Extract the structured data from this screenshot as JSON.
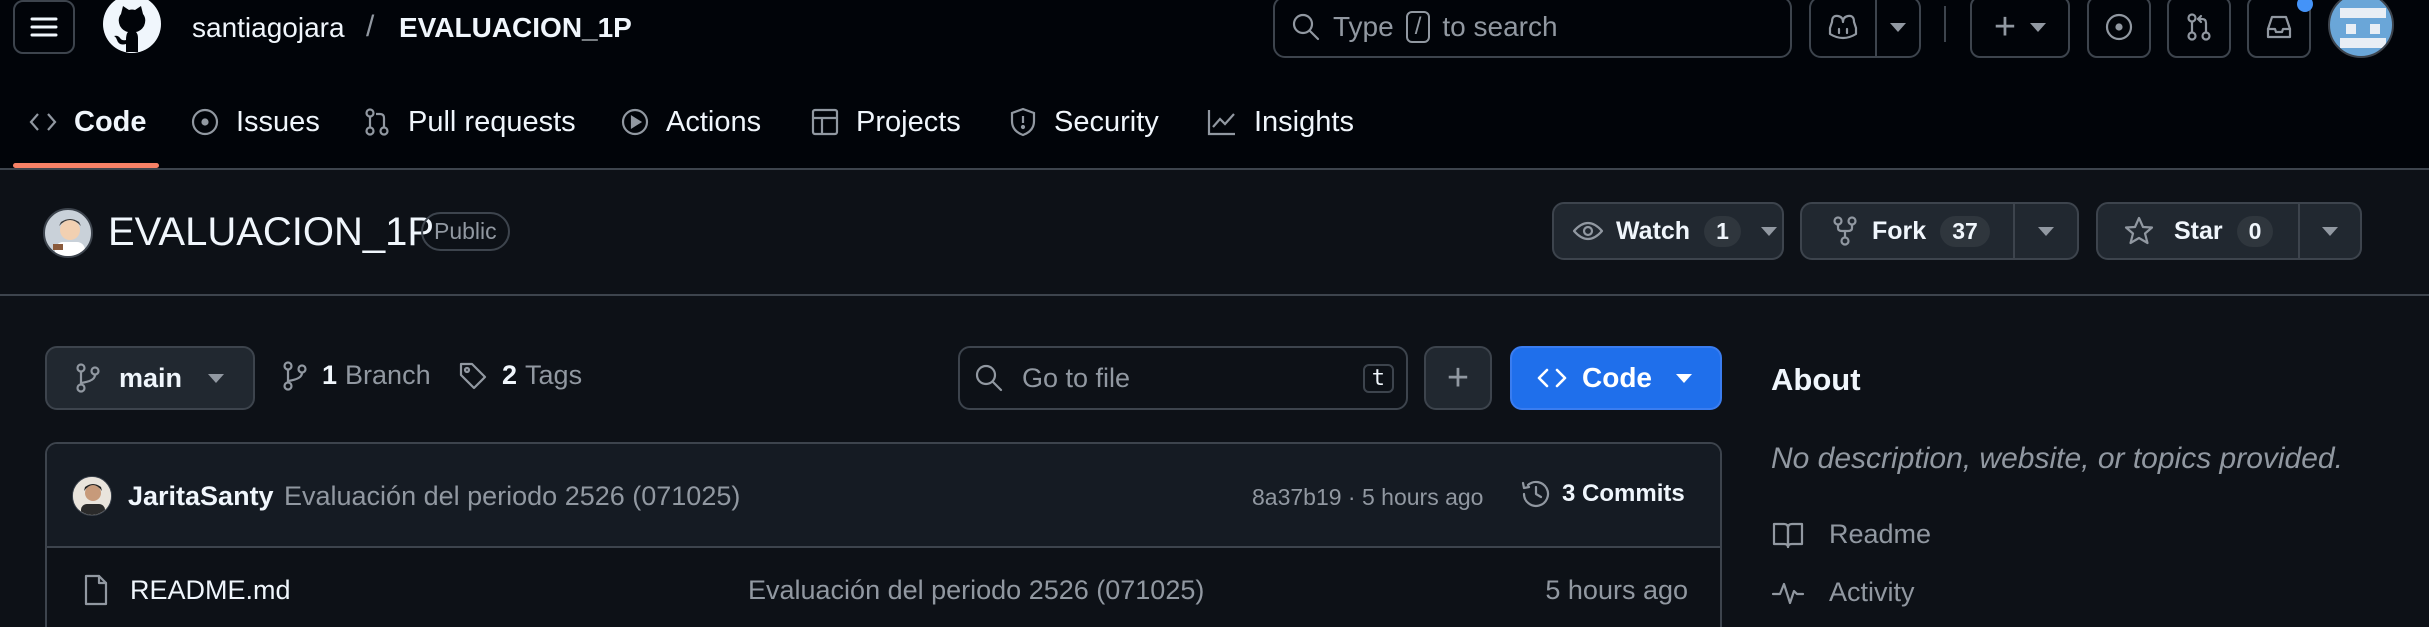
{
  "header": {
    "owner": "santiagojara",
    "separator": "/",
    "repo": "EVALUACION_1P",
    "search_placeholder_pre": "Type",
    "search_key": "/",
    "search_placeholder_post": "to search",
    "add_label": "+"
  },
  "tabs": [
    {
      "label": "Code",
      "icon": "code-icon",
      "selected": true
    },
    {
      "label": "Issues",
      "icon": "issue-icon"
    },
    {
      "label": "Pull requests",
      "icon": "pull-request-icon"
    },
    {
      "label": "Actions",
      "icon": "play-icon"
    },
    {
      "label": "Projects",
      "icon": "table-icon"
    },
    {
      "label": "Security",
      "icon": "shield-icon"
    },
    {
      "label": "Insights",
      "icon": "graph-icon"
    }
  ],
  "repo_header": {
    "name": "EVALUACION_1P",
    "visibility": "Public",
    "watch_label": "Watch",
    "watch_count": "1",
    "fork_label": "Fork",
    "fork_count": "37",
    "star_label": "Star",
    "star_count": "0"
  },
  "toolbar": {
    "branch": "main",
    "branch_count": "1",
    "branch_label": "Branch",
    "tag_count": "2",
    "tag_label": "Tags",
    "goto_placeholder": "Go to file",
    "goto_key": "t",
    "add_label": "+",
    "code_label": "Code"
  },
  "commit": {
    "author": "JaritaSanty",
    "message": "Evaluación del periodo 2526 (071025)",
    "hash_time": "8a37b19 · 5 hours ago",
    "commits_label": "3 Commits"
  },
  "files": [
    {
      "name": "README.md",
      "message": "Evaluación del periodo 2526 (071025)",
      "time": "5 hours ago",
      "icon": "file-icon"
    }
  ],
  "about": {
    "title": "About",
    "description": "No description, website, or topics provided.",
    "links": [
      {
        "label": "Readme",
        "icon": "book-icon"
      },
      {
        "label": "Activity",
        "icon": "pulse-icon"
      }
    ]
  },
  "colors": {
    "accent_blue": "#1f6feb",
    "tab_underline": "#f78166",
    "notification_dot": "#4493f8"
  }
}
